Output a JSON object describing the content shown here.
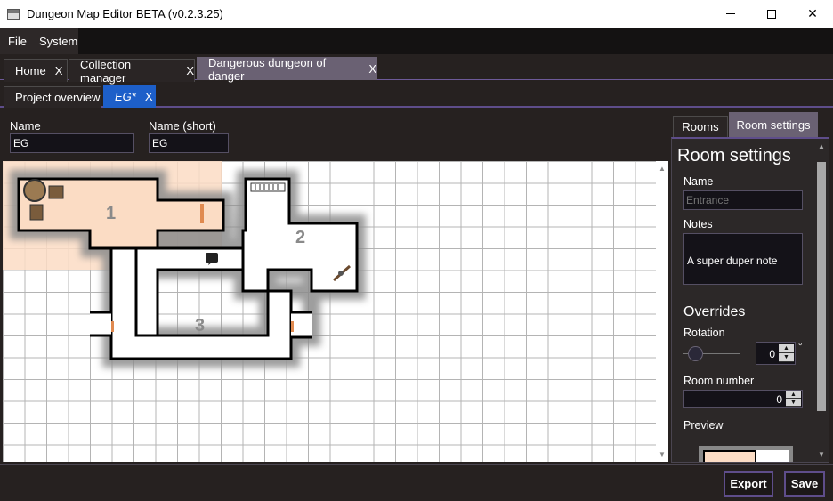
{
  "window": {
    "title": "Dungeon Map Editor BETA (v0.2.3.25)",
    "minimize": "",
    "maximize": "",
    "close": "✕"
  },
  "menu": {
    "file": "File",
    "system": "System"
  },
  "tabs": [
    {
      "label": "Home",
      "close": "X"
    },
    {
      "label": "Collection manager",
      "close": "X"
    },
    {
      "label": "Dangerous dungeon of danger",
      "close": "X"
    }
  ],
  "subtabs": [
    {
      "label": "Project overview"
    },
    {
      "label": "EG*",
      "close": "X"
    }
  ],
  "fields": {
    "name_label": "Name",
    "name_value": "EG",
    "short_label": "Name (short)",
    "short_value": "EG"
  },
  "map": {
    "room_numbers": [
      "1",
      "2",
      "3"
    ],
    "up_arrow": "▲",
    "down_arrow": "▼"
  },
  "right_tabs": {
    "rooms": "Rooms",
    "room_settings": "Room settings"
  },
  "room_settings": {
    "heading": "Room settings",
    "name_label": "Name",
    "name_placeholder": "Entrance",
    "notes_label": "Notes",
    "notes_value": "A super duper note",
    "overrides_heading": "Overrides",
    "rotation_label": "Rotation",
    "rotation_value": "0",
    "rotation_unit": "°",
    "room_number_label": "Room number",
    "room_number_value": "0",
    "preview_label": "Preview",
    "spin_up": "▲",
    "spin_down": "▼"
  },
  "buttons": {
    "export": "Export",
    "save": "Save"
  },
  "colors": {
    "accent": "#5e4d8a",
    "active_tab": "#6a6173",
    "blue_tab": "#1d5fc9",
    "room_highlight": "#fbdcc4"
  }
}
